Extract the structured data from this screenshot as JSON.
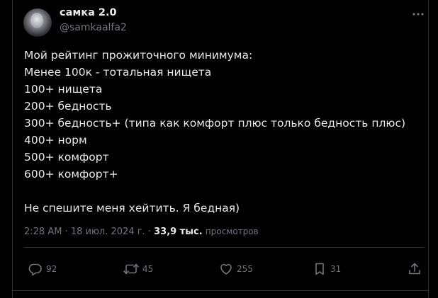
{
  "author": {
    "display_name": "самка 2.0",
    "handle": "@samkaalfa2"
  },
  "tweet": {
    "lines": [
      "Мой рейтинг прожиточного минимума:",
      "Менее 100к - тотальная нищета",
      "100+ нищета",
      "200+ бедность",
      "300+ бедность+ (типа как комфорт плюс только бедность плюс)",
      "400+ норм",
      "500+ комфорт",
      "600+ комфорт+",
      "",
      "Не спешите меня хейтить. Я бедная)"
    ]
  },
  "meta": {
    "time": "2:28 AM",
    "separator": "·",
    "date": "18 июл. 2024 г.",
    "views_count": "33,9 тыс.",
    "views_label": "просмотров"
  },
  "actions": {
    "replies": "92",
    "reposts": "45",
    "likes": "255",
    "bookmarks": "31"
  },
  "colors": {
    "background": "#000000",
    "text": "#e7e9ea",
    "secondary": "#71767b",
    "border": "#2f3336"
  },
  "icons": [
    "more-icon",
    "reply-icon",
    "repost-icon",
    "like-icon",
    "bookmark-icon",
    "share-icon"
  ]
}
